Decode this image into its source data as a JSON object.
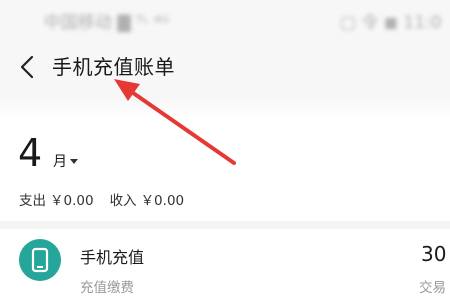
{
  "status_bar": {
    "left_text": "中国移动 ▇ ᵀᴸ ⁴ᴳ",
    "right_text": "▢ 令 ◼ 11:0"
  },
  "header": {
    "title": "手机充值账单"
  },
  "period": {
    "month": "4",
    "unit": "月"
  },
  "summary": {
    "expense_label": "支出",
    "expense_value": "￥0.00",
    "income_label": "收入",
    "income_value": "￥0.00"
  },
  "bills": [
    {
      "name": "手机充值",
      "category": "充值缴费",
      "amount": "30",
      "status": "交易"
    }
  ],
  "colors": {
    "accent": "#26a69a",
    "annotation": "#e53935"
  }
}
